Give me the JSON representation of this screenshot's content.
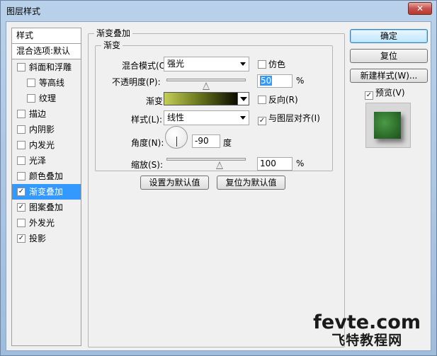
{
  "window": {
    "title": "图层样式",
    "close_label": "✕"
  },
  "stylelist": {
    "header": "样式",
    "blend_options": "混合选项:默认",
    "items": [
      {
        "label": "斜面和浮雕",
        "checked": false,
        "sub": false,
        "active": false
      },
      {
        "label": "等高线",
        "checked": false,
        "sub": true,
        "active": false
      },
      {
        "label": "纹理",
        "checked": false,
        "sub": true,
        "active": false
      },
      {
        "label": "描边",
        "checked": false,
        "sub": false,
        "active": false
      },
      {
        "label": "内阴影",
        "checked": false,
        "sub": false,
        "active": false
      },
      {
        "label": "内发光",
        "checked": false,
        "sub": false,
        "active": false
      },
      {
        "label": "光泽",
        "checked": false,
        "sub": false,
        "active": false
      },
      {
        "label": "颜色叠加",
        "checked": false,
        "sub": false,
        "active": false
      },
      {
        "label": "渐变叠加",
        "checked": true,
        "sub": false,
        "active": true
      },
      {
        "label": "图案叠加",
        "checked": true,
        "sub": false,
        "active": false
      },
      {
        "label": "外发光",
        "checked": false,
        "sub": false,
        "active": false
      },
      {
        "label": "投影",
        "checked": true,
        "sub": false,
        "active": false
      }
    ]
  },
  "panel": {
    "group_title": "渐变叠加",
    "subgroup_title": "渐变",
    "blend_mode_label": "混合模式(O):",
    "blend_mode_value": "强光",
    "dither_label": "仿色",
    "opacity_label": "不透明度(P):",
    "opacity_value": "50",
    "opacity_unit": "%",
    "opacity_level": 0.5,
    "gradient_label": "渐变:",
    "reverse_label": "反向(R)",
    "style_label": "样式(L):",
    "style_value": "线性",
    "align_label": "与图层对齐(I)",
    "angle_label": "角度(N):",
    "angle_value": "-90",
    "angle_unit": "度",
    "scale_label": "缩放(S):",
    "scale_value": "100",
    "scale_unit": "%",
    "set_default_label": "设置为默认值",
    "reset_default_label": "复位为默认值"
  },
  "checks": {
    "dither": false,
    "reverse": false,
    "align": true,
    "preview": true
  },
  "right": {
    "ok_label": "确定",
    "reset_label": "复位",
    "new_style_label": "新建样式(W)...",
    "preview_label": "预览(V)"
  },
  "watermark": {
    "top": "fevte.com",
    "bottom": "飞特教程网"
  }
}
